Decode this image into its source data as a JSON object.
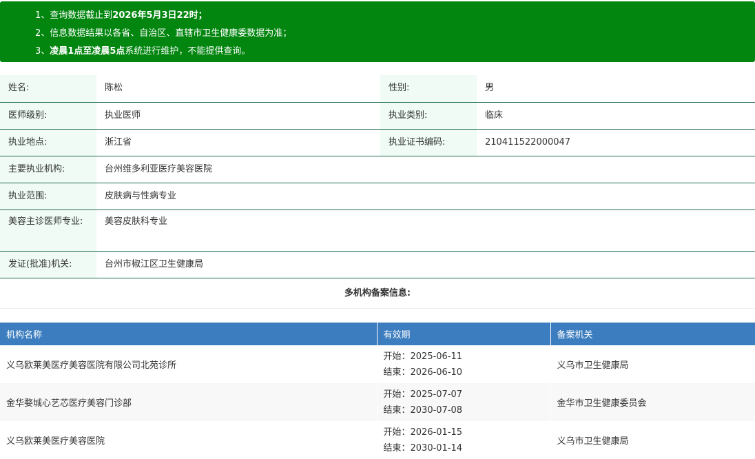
{
  "notice": {
    "line1_prefix": "1、查询数据截止到",
    "line1_bold": "2026年5月3日22时；",
    "line2": "2、信息数据结果以各省、自治区、直辖市卫生健康委数据为准；",
    "line3_prefix": "3、",
    "line3_bold": "凌晨1点至凌晨5点",
    "line3_suffix": "系统进行维护，不能提供查询。"
  },
  "doctor": {
    "name_label": "姓名:",
    "name": "陈松",
    "gender_label": "性别:",
    "gender": "男",
    "level_label": "医师级别:",
    "level": "执业医师",
    "category_label": "执业类别:",
    "category": "临床",
    "location_label": "执业地点:",
    "location": "浙江省",
    "cert_label": "执业证书编码:",
    "cert": "210411522000047",
    "org_label": "主要执业机构:",
    "org": "台州维多利亚医疗美容医院",
    "scope_label": "执业范围:",
    "scope": "皮肤病与性病专业",
    "cosmetic_label": "美容主诊医师专业:",
    "cosmetic": "美容皮肤科专业",
    "issuer_label": "发证(批准)机关:",
    "issuer": "台州市椒江区卫生健康局"
  },
  "multi_org": {
    "title": "多机构备案信息:",
    "headers": [
      "机构名称",
      "有效期",
      "备案机关"
    ],
    "rows": [
      {
        "name": "义乌欧莱美医疗美容医院有限公司北苑诊所",
        "start": "开始：2025-06-11",
        "end": "结束：2026-06-10",
        "authority": "义乌市卫生健康局"
      },
      {
        "name": "金华婺城心艺芯医疗美容门诊部",
        "start": "开始：2025-07-07",
        "end": "结束：2030-07-08",
        "authority": "金华市卫生健康委员会"
      },
      {
        "name": "义乌欧莱美医疗美容医院",
        "start": "开始：2026-01-15",
        "end": "结束：2030-01-14",
        "authority": "义乌市卫生健康局"
      }
    ]
  }
}
